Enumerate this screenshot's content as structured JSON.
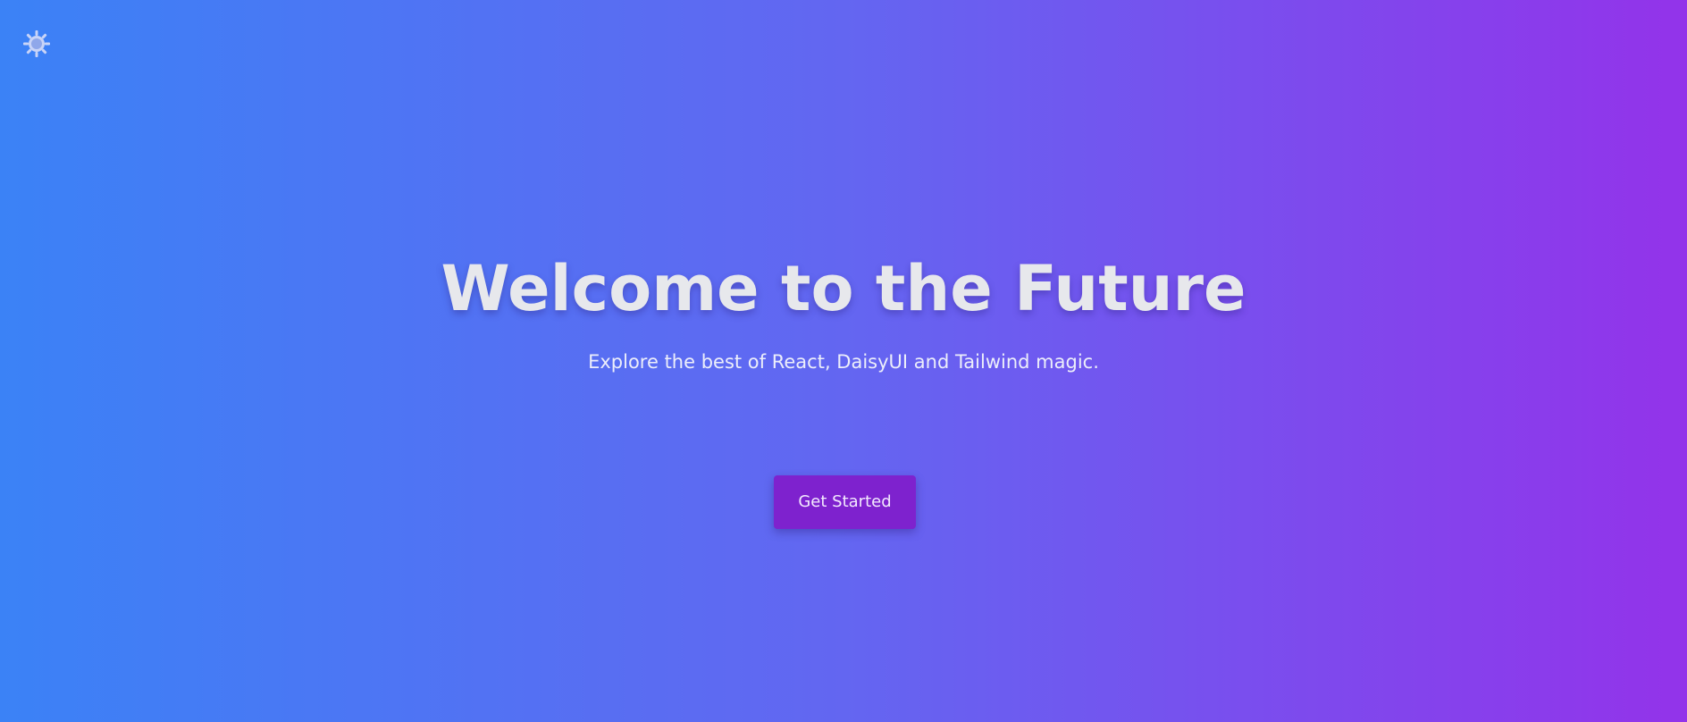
{
  "theme": {
    "background_gradient": [
      "#3b82f6",
      "#6366f1",
      "#9333ea"
    ],
    "button_color": "#7e22ce",
    "text_color": "#e7e8ec"
  },
  "header": {
    "theme_toggle_icon": "sun-icon"
  },
  "hero": {
    "title": "Welcome to the Future",
    "subtitle": "Explore the best of React, DaisyUI and Tailwind magic.",
    "cta_label": "Get Started"
  }
}
